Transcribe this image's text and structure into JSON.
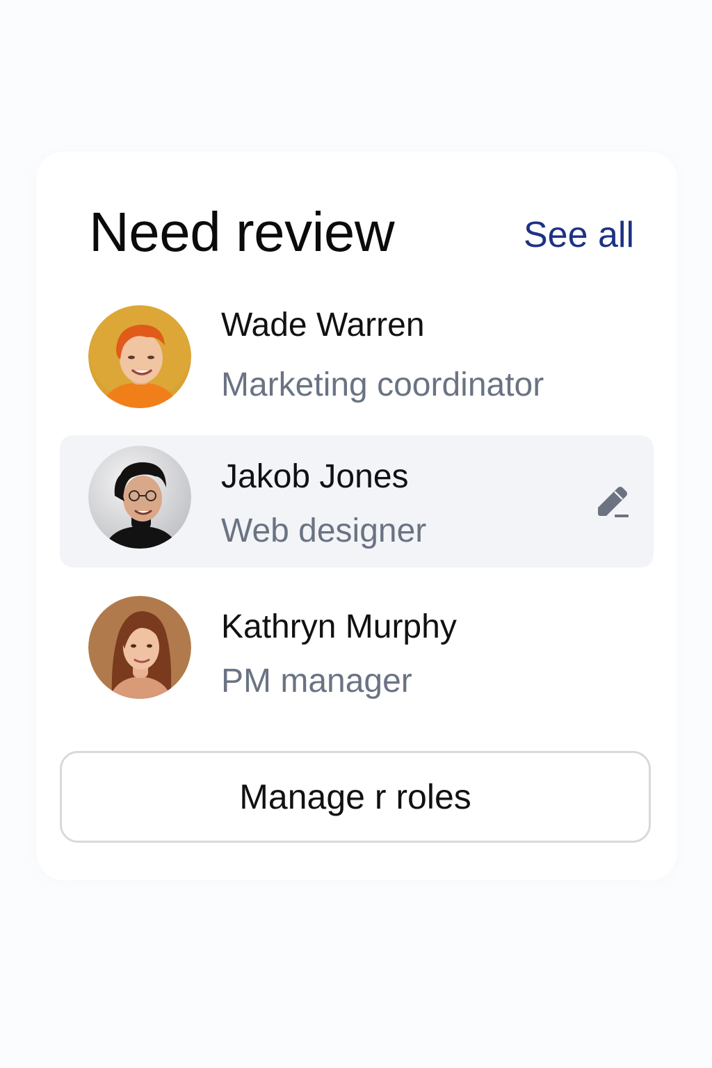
{
  "header": {
    "title": "Need review",
    "see_all_label": "See all"
  },
  "reviewers": [
    {
      "name": "Wade Warren",
      "role": "Marketing coordinator",
      "avatar_bg": "#d9a233"
    },
    {
      "name": "Jakob Jones",
      "role": "Web designer",
      "avatar_bg": "#d6d6d8",
      "selected": true,
      "action_icon": "edit-pencil-icon"
    },
    {
      "name": "Kathryn Murphy",
      "role": "PM manager",
      "avatar_bg": "#b07a4c"
    }
  ],
  "footer": {
    "manage_button_label": "Manage r roles"
  },
  "colors": {
    "accent": "#1d3284",
    "selected_row_bg": "#f3f4f7",
    "secondary_text": "#6a7383"
  }
}
